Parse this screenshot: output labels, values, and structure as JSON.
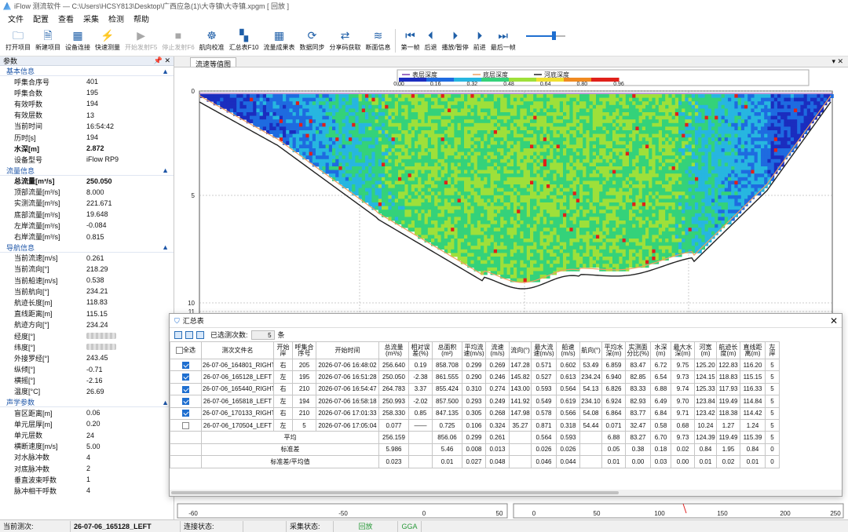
{
  "window": {
    "title": "iFlow 测流软件 — C:\\Users\\HCSY813\\Desktop\\广西应急(1)\\大寺镇\\大寺镇.xpgm [ 回放 ]"
  },
  "menu": [
    "文件",
    "配置",
    "查看",
    "采集",
    "检测",
    "帮助"
  ],
  "toolbar": [
    {
      "label": "打开项目",
      "icon": "🗀",
      "disabled": false
    },
    {
      "label": "新建项目",
      "icon": "🗎",
      "disabled": false
    },
    {
      "label": "设备连接",
      "icon": "▦",
      "disabled": false
    },
    {
      "label": "快速测量",
      "icon": "⚡",
      "disabled": false
    },
    {
      "label": "开始发射F5",
      "icon": "▶",
      "disabled": true
    },
    {
      "label": "停止发射F6",
      "icon": "■",
      "disabled": true
    },
    {
      "label": "航向校准",
      "icon": "☸",
      "disabled": false
    },
    {
      "label": "汇总表F10",
      "icon": "▚",
      "disabled": false
    },
    {
      "label": "流量成果表",
      "icon": "▦",
      "disabled": false
    },
    {
      "label": "数据同步",
      "icon": "⟳",
      "disabled": false
    },
    {
      "label": "分享码获取",
      "icon": "⇄",
      "disabled": false
    },
    {
      "label": "断面信息",
      "icon": "≋",
      "disabled": false
    }
  ],
  "playback": [
    {
      "label": "第一帧",
      "icon": "⏮"
    },
    {
      "label": "后退",
      "icon": "⏴"
    },
    {
      "label": "播放/暂停",
      "icon": "⏵"
    },
    {
      "label": "前进",
      "icon": "⏵"
    },
    {
      "label": "最后一帧",
      "icon": "⏭"
    }
  ],
  "speed_slider": {
    "value": 0.7
  },
  "params": {
    "panel_title": "参数",
    "sections": [
      {
        "title": "基本信息",
        "rows": [
          {
            "k": "呼集合序号",
            "v": "401"
          },
          {
            "k": "呼集合数",
            "v": "195"
          },
          {
            "k": "有效呼数",
            "v": "194"
          },
          {
            "k": "有效层数",
            "v": "13"
          },
          {
            "k": "当前时间",
            "v": "16:54:42"
          },
          {
            "k": "历时[s]",
            "v": "194"
          },
          {
            "k": "水深[m]",
            "v": "2.872",
            "bold": true
          },
          {
            "k": "设备型号",
            "v": "iFlow RP9"
          }
        ]
      },
      {
        "title": "流量信息",
        "rows": [
          {
            "k": "总流量[m³/s]",
            "v": "250.050",
            "bold": true
          },
          {
            "k": "顶部流量[m³/s]",
            "v": "8.000"
          },
          {
            "k": "实测流量[m³/s]",
            "v": "221.671"
          },
          {
            "k": "底部流量[m³/s]",
            "v": "19.648"
          },
          {
            "k": "左岸流量[m³/s]",
            "v": "-0.084"
          },
          {
            "k": "右岸流量[m³/s]",
            "v": "0.815"
          }
        ]
      },
      {
        "title": "导航信息",
        "rows": [
          {
            "k": "当前流速[m/s]",
            "v": "0.261"
          },
          {
            "k": "当前流向[°]",
            "v": "218.29"
          },
          {
            "k": "当前船速[m/s]",
            "v": "0.538"
          },
          {
            "k": "当前航向[°]",
            "v": "234.21"
          },
          {
            "k": "航迹长度[m]",
            "v": "118.83"
          },
          {
            "k": "直线距离[m]",
            "v": "115.15"
          },
          {
            "k": "航迹方向[°]",
            "v": "234.24"
          },
          {
            "k": "经度[°]",
            "v": "",
            "blur": true
          },
          {
            "k": "纬度[°]",
            "v": "",
            "blur": true
          },
          {
            "k": "外接罗经[°]",
            "v": "243.45"
          },
          {
            "k": "纵倾[°]",
            "v": "-0.71"
          },
          {
            "k": "横摇[°]",
            "v": "-2.16"
          },
          {
            "k": "温度[°C]",
            "v": "26.69"
          }
        ]
      },
      {
        "title": "声学参数",
        "rows": [
          {
            "k": "盲区距离[m]",
            "v": "0.06"
          },
          {
            "k": "单元层厚[m]",
            "v": "0.20"
          },
          {
            "k": "单元层数",
            "v": "24"
          },
          {
            "k": "横断速度[m/s]",
            "v": "5.00"
          },
          {
            "k": "对水脉冲数",
            "v": "4"
          },
          {
            "k": "对底脉冲数",
            "v": "2"
          },
          {
            "k": "垂直波束呼数",
            "v": "1"
          },
          {
            "k": "脉冲相干呼数",
            "v": "4"
          }
        ]
      }
    ]
  },
  "main_tab": {
    "label": "流速等值图"
  },
  "plot": {
    "legend": [
      "表层深度",
      "底层深度",
      "河底深度"
    ],
    "legend_colors": [
      "#7b3fb0",
      "#f0a060",
      "#222222"
    ],
    "colorbar_ticks": [
      "0.00",
      "0.16",
      "0.32",
      "0.48",
      "0.64",
      "0.80",
      "0.96"
    ],
    "y_ticks": [
      "0",
      "5",
      "10",
      "11"
    ],
    "bottom_left_ticks": [
      "-60",
      "-50",
      "0",
      "50"
    ],
    "bottom_right_ticks": [
      "0",
      "50",
      "100",
      "150",
      "200",
      "250"
    ]
  },
  "summary": {
    "title": "汇总表",
    "selected_label": "已选测次数:",
    "selected_count": "5",
    "selected_unit": "条",
    "headers": [
      "全选",
      "测次文件名",
      "开始岸",
      "呼集合序号",
      "开始时间",
      "总流量(m³/s)",
      "相对误差(%)",
      "总面积(m²)",
      "平均流速(m/s)",
      "流速(m/s)",
      "流向(°)",
      "最大流速(m/s)",
      "船速(m/s)",
      "航向(°)",
      "平均水深(m)",
      "实测面分比(%)",
      "水深(m)",
      "最大水深(m)",
      "河宽(m)",
      "航迹长度(m)",
      "直线距离(m)",
      "左岸"
    ],
    "rows": [
      {
        "checked": true,
        "cells": [
          "26-07-06_164801_RIGHT",
          "右",
          "205",
          "2026-07-06 16:48:02",
          "256.640",
          "0.19",
          "858.708",
          "0.299",
          "0.269",
          "147.28",
          "0.571",
          "0.602",
          "53.49",
          "6.859",
          "83.47",
          "6.72",
          "9.75",
          "125.20",
          "122.83",
          "116.20",
          "5"
        ]
      },
      {
        "checked": true,
        "cells": [
          "26-07-06_165128_LEFT",
          "左",
          "195",
          "2026-07-06 16:51:28",
          "250.050",
          "-2.38",
          "861.555",
          "0.290",
          "0.246",
          "145.82",
          "0.527",
          "0.613",
          "234.24",
          "6.940",
          "82.85",
          "6.54",
          "9.73",
          "124.15",
          "118.83",
          "115.15",
          "5"
        ]
      },
      {
        "checked": true,
        "cells": [
          "26-07-06_165440_RIGHT",
          "右",
          "210",
          "2026-07-06 16:54:47",
          "264.783",
          "3.37",
          "855.424",
          "0.310",
          "0.274",
          "143.00",
          "0.593",
          "0.564",
          "54.13",
          "6.826",
          "83.33",
          "6.88",
          "9.74",
          "125.33",
          "117.93",
          "116.33",
          "5"
        ]
      },
      {
        "checked": true,
        "cells": [
          "26-07-06_165818_LEFT",
          "左",
          "194",
          "2026-07-06 16:58:18",
          "250.993",
          "-2.02",
          "857.500",
          "0.293",
          "0.249",
          "141.92",
          "0.549",
          "0.619",
          "234.10",
          "6.924",
          "82.93",
          "6.49",
          "9.70",
          "123.84",
          "119.49",
          "114.84",
          "5"
        ]
      },
      {
        "checked": true,
        "cells": [
          "26-07-06_170133_RIGHT",
          "右",
          "210",
          "2026-07-06 17:01:33",
          "258.330",
          "0.85",
          "847.135",
          "0.305",
          "0.268",
          "147.98",
          "0.578",
          "0.566",
          "54.08",
          "6.864",
          "83.77",
          "6.84",
          "9.71",
          "123.42",
          "118.38",
          "114.42",
          "5"
        ]
      },
      {
        "checked": false,
        "cells": [
          "26-07-06_170504_LEFT",
          "左",
          "5",
          "2026-07-06 17:05:04",
          "0.077",
          "——",
          "0.725",
          "0.106",
          "0.324",
          "35.27",
          "0.871",
          "0.318",
          "54.44",
          "0.071",
          "32.47",
          "0.58",
          "0.68",
          "10.24",
          "1.27",
          "1.24",
          "5"
        ]
      }
    ],
    "stats": [
      {
        "label": "平均",
        "cells": [
          "256.159",
          "",
          "856.06",
          "0.299",
          "0.261",
          "",
          "0.564",
          "0.593",
          "",
          "6.88",
          "83.27",
          "6.70",
          "9.73",
          "124.39",
          "119.49",
          "115.39",
          "5"
        ]
      },
      {
        "label": "标准差",
        "cells": [
          "5.986",
          "",
          "5.46",
          "0.008",
          "0.013",
          "",
          "0.026",
          "0.026",
          "",
          "0.05",
          "0.38",
          "0.18",
          "0.02",
          "0.84",
          "1.95",
          "0.84",
          "0"
        ]
      },
      {
        "label": "标准差/平均值",
        "cells": [
          "0.023",
          "",
          "0.01",
          "0.027",
          "0.048",
          "",
          "0.046",
          "0.044",
          "",
          "0.01",
          "0.00",
          "0.03",
          "0.00",
          "0.01",
          "0.02",
          "0.01",
          "0"
        ]
      }
    ]
  },
  "status": {
    "measure_label": "当前测次:",
    "measure_value": "26-07-06_165128_LEFT",
    "conn_label": "连接状态:",
    "conn_value": "",
    "collect_label": "采集状态:",
    "collect_value": "回放",
    "gga": "GGA"
  },
  "colors": {
    "accent": "#1f6fd0",
    "section": "#1e56a8",
    "green_status": "#2a9a3a"
  }
}
